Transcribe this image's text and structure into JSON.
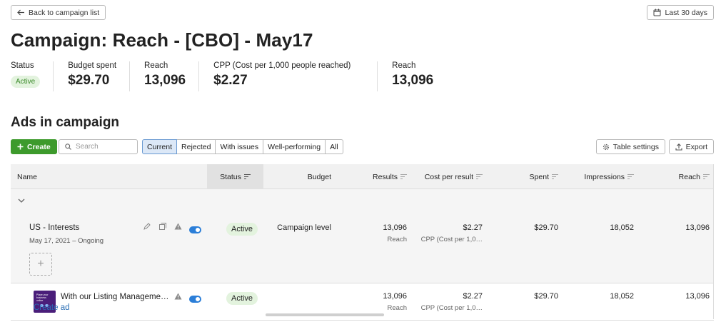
{
  "header": {
    "back_label": "Back to campaign list",
    "date_range_label": "Last 30 days",
    "title": "Campaign: Reach - [CBO] - May17"
  },
  "stats": [
    {
      "label": "Status",
      "badge": "Active"
    },
    {
      "label": "Budget spent",
      "value": "$29.70"
    },
    {
      "label": "Reach",
      "value": "13,096"
    },
    {
      "label": "CPP (Cost per 1,000 people reached)",
      "value": "$2.27"
    },
    {
      "label": "Reach",
      "value": "13,096"
    }
  ],
  "section_title": "Ads in campaign",
  "toolbar": {
    "create_label": "Create",
    "search_placeholder": "Search",
    "filters": [
      "Current",
      "Rejected",
      "With issues",
      "Well-performing",
      "All"
    ],
    "active_filter": "Current",
    "table_settings_label": "Table settings",
    "export_label": "Export"
  },
  "table": {
    "columns": [
      "Name",
      "Status",
      "Budget",
      "Results",
      "Cost per result",
      "Spent",
      "Impressions",
      "Reach"
    ],
    "ad_set": {
      "name": "US - Interests",
      "dates": "May 17, 2021 – Ongoing",
      "status": "Active",
      "budget": "Campaign level",
      "results": "13,096",
      "results_sub": "Reach",
      "cost_per_result": "$2.27",
      "cost_per_result_sub": "CPP (Cost per 1,0…",
      "spent": "$29.70",
      "impressions": "18,052",
      "reach": "13,096"
    },
    "ad": {
      "name": "With our Listing Manageme…",
      "thumb_text": "Place your business online",
      "status": "Active",
      "results": "13,096",
      "results_sub": "Reach",
      "cost_per_result": "$2.27",
      "cost_per_result_sub": "CPP (Cost per 1,0…",
      "spent": "$29.70",
      "impressions": "18,052",
      "reach": "13,096"
    }
  },
  "create_ad_label": "Create ad",
  "colors": {
    "accent_green": "#3d9a2c",
    "active_badge_bg": "#e3f3de",
    "toggle_blue": "#2b7ed8",
    "link_blue": "#2b6fb5",
    "thumb_purple": "#4a1e7a"
  },
  "icons": [
    "arrow-left-icon",
    "calendar-icon",
    "plus-icon",
    "search-icon",
    "gear-icon",
    "export-icon",
    "sort-icon",
    "chevron-down-icon",
    "pencil-icon",
    "duplicate-icon",
    "warning-icon",
    "toggle-icon"
  ]
}
